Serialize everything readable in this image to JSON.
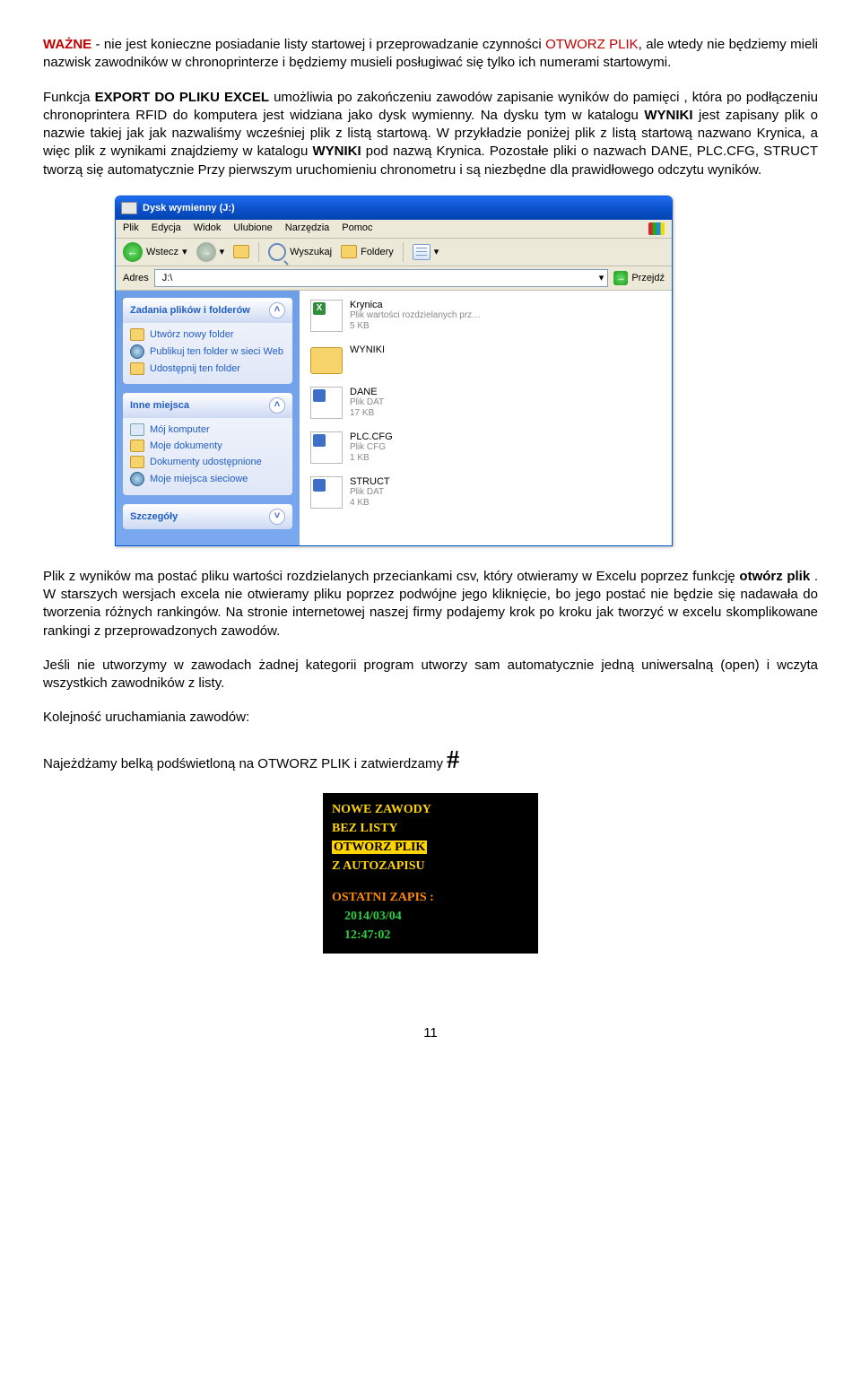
{
  "para1": {
    "lead_red": "WAŻNE",
    "t1": " - nie jest konieczne posiadanie listy startowej i przeprowadzanie czynności ",
    "otworz_red": "OTWORZ PLIK",
    "t2": ", ale wtedy nie będziemy mieli nazwisk zawodników w chronoprinterze i będziemy musieli posługiwać się tylko ich numerami startowymi."
  },
  "para2": {
    "t1": "Funkcja ",
    "export_bold": "EXPORT DO PLIKU EXCEL",
    "t2": "  umożliwia  po zakończeniu zawodów zapisanie wyników do pamięci , która po podłączeniu chronoprintera RFID do komputera jest widziana jako dysk wymienny. Na dysku tym w katalogu ",
    "wyniki1": "WYNIKI",
    "t3": " jest zapisany plik o nazwie takiej jak jak nazwaliśmy wcześniej plik z listą startową. W przykładzie poniżej plik z listą startową nazwano Krynica, a więc plik z wynikami znajdziemy w katalogu ",
    "wyniki2": "WYNIKI",
    "t4": " pod nazwą Krynica. Pozostałe pliki o nazwach  DANE, PLC.CFG, STRUCT   tworzą  się automatycznie Przy pierwszym  uruchomieniu  chronometru  i  są  niezbędne  dla  prawidłowego  odczytu wyników."
  },
  "explorer": {
    "title": "Dysk wymienny (J:)",
    "menu": [
      "Plik",
      "Edycja",
      "Widok",
      "Ulubione",
      "Narzędzia",
      "Pomoc"
    ],
    "back": "Wstecz",
    "search": "Wyszukaj",
    "folders": "Foldery",
    "addr_label": "Adres",
    "addr_value": "J:\\",
    "go": "Przejdź",
    "panel1": {
      "title": "Zadania plików i folderów",
      "items": [
        "Utwórz nowy folder",
        "Publikuj ten folder w sieci Web",
        "Udostępnij ten folder"
      ]
    },
    "panel2": {
      "title": "Inne miejsca",
      "items": [
        "Mój komputer",
        "Moje dokumenty",
        "Dokumenty udostępnione",
        "Moje miejsca sieciowe"
      ]
    },
    "panel3": {
      "title": "Szczegóły"
    },
    "files": [
      {
        "name": "Krynica",
        "sub1": "Plik wartości rozdzielanych prz…",
        "sub2": "5 KB",
        "kind": "excel"
      },
      {
        "name": "WYNIKI",
        "sub1": "",
        "sub2": "",
        "kind": "folder"
      },
      {
        "name": "DANE",
        "sub1": "Plik DAT",
        "sub2": "17 KB",
        "kind": "generic"
      },
      {
        "name": "PLC.CFG",
        "sub1": "Plik CFG",
        "sub2": "1 KB",
        "kind": "generic"
      },
      {
        "name": "STRUCT",
        "sub1": "Plik DAT",
        "sub2": "4 KB",
        "kind": "generic"
      }
    ]
  },
  "para3": {
    "t1": "Plik  z  wyników  ma  postać  pliku  wartości  rozdzielanych  przeciankami  csv,  który otwieramy    w Excelu poprzez funkcję ",
    "b1": "otwórz plik",
    "t2": " . W starszych wersjach excela nie  otwieramy pliku poprzez podwójne jego kliknięcie, bo jego postać nie będzie się nadawała do tworzenia różnych rankingów. Na stronie internetowej naszej firmy podajemy krok po kroku jak tworzyć w excelu skomplikowane rankingi z przeprowadzonych zawodów."
  },
  "para4": "Jeśli nie utworzymy w zawodach żadnej kategorii program utworzy sam automatycznie jedną uniwersalną (open) i wczyta wszystkich zawodników z listy.",
  "para5": "Kolejność uruchamiania zawodów:",
  "para6": {
    "t1": "Najeżdżamy belką podświetloną na OTWORZ PLIK i zatwierdzamy  ",
    "hash": "#"
  },
  "menu": {
    "rows": [
      "NOWE ZAWODY",
      "BEZ LISTY",
      "OTWORZ PLIK",
      "Z AUTOZAPISU"
    ],
    "status_label": "OSTATNI ZAPIS :",
    "date": "2014/03/04",
    "time": "12:47:02"
  },
  "page_number": "11"
}
